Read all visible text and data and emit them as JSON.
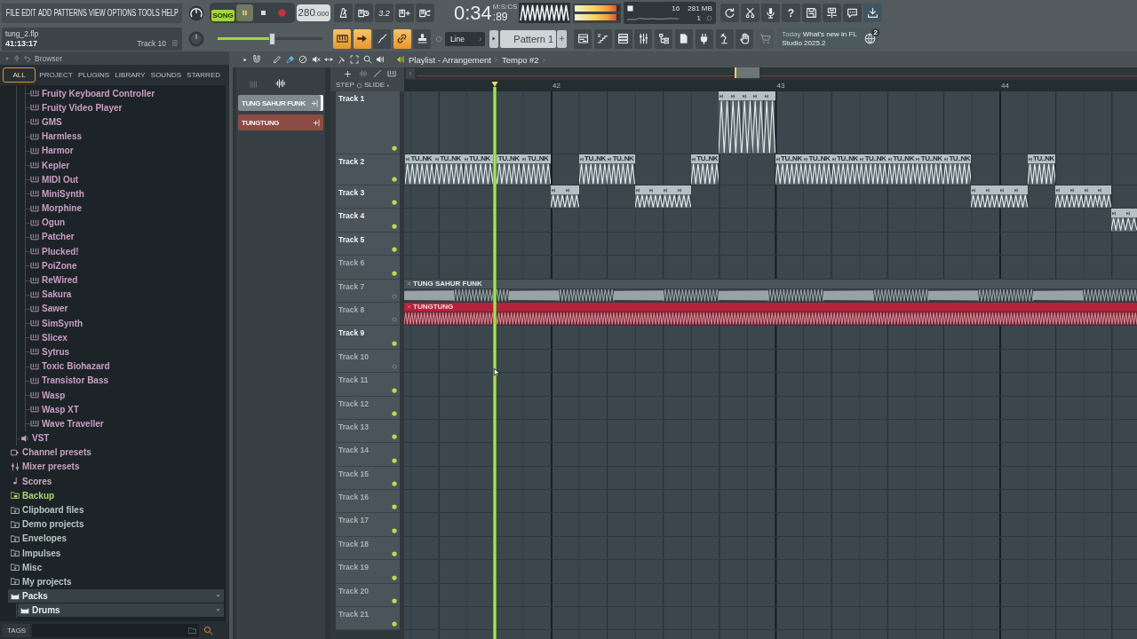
{
  "menu": [
    "FILE",
    "EDIT",
    "ADD",
    "PATTERNS",
    "VIEW",
    "OPTIONS",
    "TOOLS",
    "HELP"
  ],
  "transport": {
    "mode": "SONG",
    "song_mode": true,
    "playing": true,
    "recording": false,
    "tempo": "280",
    "tempo_fraction": ".000"
  },
  "countdown": "3.2",
  "clock": {
    "time": "0:34",
    "fraction": ":89",
    "unit": "M:S:CS"
  },
  "meter": [
    {
      "level": 0.95
    },
    {
      "level": 0.95
    }
  ],
  "cpu": {
    "value": "16",
    "memory": "281 MB",
    "polyphony": "1"
  },
  "help": "?",
  "song_info": {
    "file": "tung_2.flp",
    "position": "41:13:17",
    "hint": "Track 10"
  },
  "master_volume": {
    "level": 0.52
  },
  "mode_buttons": [
    {
      "on": true
    },
    {
      "on": true
    },
    {
      "on": false
    },
    {
      "on": true
    },
    {
      "on": false
    }
  ],
  "snap": "Line",
  "pattern_selector": "Pattern 1",
  "news": {
    "prefix": "Today",
    "text": "What's new in FL Studio 2025.2",
    "badge": "2"
  },
  "browser": {
    "title": "Browser",
    "tabs": [
      {
        "label": "ALL",
        "selected": true
      },
      {
        "label": "PROJECT",
        "selected": false
      },
      {
        "label": "PLUGINS",
        "selected": false
      },
      {
        "label": "LIBRARY",
        "selected": false
      },
      {
        "label": "SOUNDS",
        "selected": false
      },
      {
        "label": "STARRED",
        "selected": false
      }
    ],
    "tree": [
      {
        "children": [
          {
            "children": [
              {
                "kind": "plugin",
                "label": "Fruity Keyboard Controller"
              },
              {
                "kind": "plugin",
                "label": "Fruity Video Player"
              },
              {
                "kind": "plugin",
                "label": "GMS"
              },
              {
                "kind": "plugin",
                "label": "Harmless"
              },
              {
                "kind": "plugin",
                "label": "Harmor"
              },
              {
                "kind": "plugin",
                "label": "Kepler"
              },
              {
                "kind": "plugin",
                "label": "MIDI Out"
              },
              {
                "kind": "plugin",
                "label": "MiniSynth"
              },
              {
                "kind": "plugin",
                "label": "Morphine"
              },
              {
                "kind": "plugin",
                "label": "Ogun"
              },
              {
                "kind": "plugin",
                "label": "Patcher"
              },
              {
                "kind": "plugin",
                "label": "Plucked!"
              },
              {
                "kind": "plugin",
                "label": "PoiZone"
              },
              {
                "kind": "plugin",
                "label": "ReWired"
              },
              {
                "kind": "plugin",
                "label": "Sakura"
              },
              {
                "kind": "plugin",
                "label": "Sawer"
              },
              {
                "kind": "plugin",
                "label": "SimSynth"
              },
              {
                "kind": "plugin",
                "label": "Slicex"
              },
              {
                "kind": "plugin",
                "label": "Sytrus"
              },
              {
                "kind": "plugin",
                "label": "Toxic Biohazard"
              },
              {
                "kind": "plugin",
                "label": "Transistor Bass"
              },
              {
                "kind": "plugin",
                "label": "Wasp"
              },
              {
                "kind": "plugin",
                "label": "Wasp XT"
              },
              {
                "kind": "plugin",
                "label": "Wave Traveller"
              }
            ]
          },
          {
            "kind": "vst",
            "label": "VST",
            "expanded": false
          }
        ]
      },
      {
        "kind": "channels",
        "label": "Channel presets",
        "expanded": false
      },
      {
        "kind": "mixer",
        "label": "Mixer presets",
        "expanded": false
      },
      {
        "kind": "scores",
        "label": "Scores",
        "expanded": false
      },
      {
        "kind": "backup",
        "label": "Backup",
        "expanded": false
      },
      {
        "kind": "folder",
        "label": "Clipboard files",
        "expanded": false
      },
      {
        "kind": "folder",
        "label": "Demo projects",
        "expanded": false
      },
      {
        "kind": "folder",
        "label": "Envelopes",
        "expanded": false
      },
      {
        "kind": "folder",
        "label": "Impulses",
        "expanded": false
      },
      {
        "kind": "folder",
        "label": "Misc",
        "expanded": false
      },
      {
        "kind": "folder",
        "label": "My projects",
        "expanded": false
      },
      {
        "kind": "pack",
        "label": "Packs",
        "expanded": true,
        "children": [
          {
            "kind": "pack",
            "label": "Drums",
            "expanded": true
          }
        ]
      }
    ],
    "tags": "TAGS"
  },
  "playlist": {
    "tools": [
      {
        "selected": false
      },
      {
        "selected": true
      },
      {
        "selected": false
      },
      {
        "selected": false
      },
      {
        "selected": false
      },
      {
        "selected": false
      },
      {
        "selected": false
      },
      {
        "selected": false
      },
      {
        "selected": false
      }
    ],
    "title": "Playlist - Arrangement",
    "breadcrumb": "Tempo #2",
    "patterns": [
      {
        "name": "TUNG SAHUR FUNK",
        "color": "#7f8b8e",
        "selected": true
      },
      {
        "name": "TUNGTUNG",
        "color": "#8c4c45",
        "selected": false
      }
    ],
    "step": "STEP",
    "slide": "SLIDE",
    "ruler": [
      "42",
      "43",
      "44"
    ],
    "tracks": [
      {
        "name": "Track 1",
        "active": true,
        "kind": "pattern",
        "clips": [
          {
            "kind": "pattern"
          },
          {
            "kind": "pattern"
          },
          {
            "kind": "pattern"
          },
          {
            "kind": "pattern"
          },
          {
            "kind": "pattern"
          }
        ]
      },
      {
        "name": "Track 2",
        "active": true,
        "kind": "pattern",
        "clips": [
          {
            "kind": "pattern",
            "label": "TU..NK"
          },
          {
            "kind": "pattern",
            "label": "TU..NK"
          },
          {
            "kind": "pattern",
            "label": "TU..NK"
          },
          {
            "kind": "pattern",
            "label": "TU..NK"
          },
          {
            "kind": "pattern",
            "label": "TU..NK"
          },
          {
            "kind": "pattern",
            "label": "TU..NK"
          },
          {
            "kind": "pattern",
            "label": "TU..NK"
          },
          {
            "kind": "pattern",
            "label": "TU..NK"
          },
          {
            "kind": "pattern",
            "label": "TU..NK"
          },
          {
            "kind": "pattern",
            "label": "TU..NK"
          },
          {
            "kind": "pattern",
            "label": "TU..NK"
          },
          {
            "kind": "pattern",
            "label": "TU..NK"
          },
          {
            "kind": "pattern",
            "label": "TU..NK"
          },
          {
            "kind": "pattern",
            "label": "TU..NK"
          },
          {
            "kind": "pattern",
            "label": "TU..NK"
          },
          {
            "kind": "pattern",
            "label": "TU..NK"
          }
        ]
      },
      {
        "name": "Track 3",
        "active": true,
        "kind": "pattern",
        "clips": [
          {
            "kind": "pattern"
          },
          {
            "kind": "pattern"
          },
          {
            "kind": "pattern"
          },
          {
            "kind": "pattern"
          },
          {
            "kind": "pattern"
          },
          {
            "kind": "pattern"
          },
          {
            "kind": "pattern"
          },
          {
            "kind": "pattern"
          },
          {
            "kind": "pattern"
          },
          {
            "kind": "pattern"
          },
          {
            "kind": "pattern"
          },
          {
            "kind": "pattern"
          },
          {
            "kind": "pattern"
          },
          {
            "kind": "pattern"
          }
        ]
      },
      {
        "name": "Track 4",
        "active": true,
        "kind": "pattern",
        "clips": [
          {
            "kind": "pattern"
          },
          {
            "kind": "pattern"
          }
        ]
      },
      {
        "name": "Track 5",
        "active": true,
        "kind": "pattern"
      },
      {
        "name": "Track 6",
        "active": false,
        "kind": "pattern"
      },
      {
        "name": "Track 7",
        "active": false,
        "kind": "audio",
        "clips": [
          {
            "kind": "audio",
            "label": "TUNG SAHUR FUNK",
            "color": "#4a555b"
          }
        ]
      },
      {
        "name": "Track 8",
        "active": false,
        "kind": "audio",
        "clips": [
          {
            "kind": "audio",
            "label": "TUNGTUNG",
            "color": "#b3233a"
          }
        ]
      },
      {
        "name": "Track 9",
        "active": true,
        "kind": "pattern"
      },
      {
        "name": "Track 10",
        "active": false,
        "kind": "audio"
      },
      {
        "name": "Track 11",
        "active": false,
        "kind": "pattern"
      },
      {
        "name": "Track 12",
        "active": false,
        "kind": "pattern"
      },
      {
        "name": "Track 13",
        "active": false,
        "kind": "pattern"
      },
      {
        "name": "Track 14",
        "active": false,
        "kind": "pattern"
      },
      {
        "name": "Track 15",
        "active": false,
        "kind": "pattern"
      },
      {
        "name": "Track 16",
        "active": false,
        "kind": "pattern"
      },
      {
        "name": "Track 17",
        "active": false,
        "kind": "pattern"
      },
      {
        "name": "Track 18",
        "active": false,
        "kind": "pattern"
      },
      {
        "name": "Track 19",
        "active": false,
        "kind": "pattern"
      },
      {
        "name": "Track 20",
        "active": false,
        "kind": "pattern"
      },
      {
        "name": "Track 21",
        "active": false,
        "kind": "pattern"
      }
    ]
  }
}
